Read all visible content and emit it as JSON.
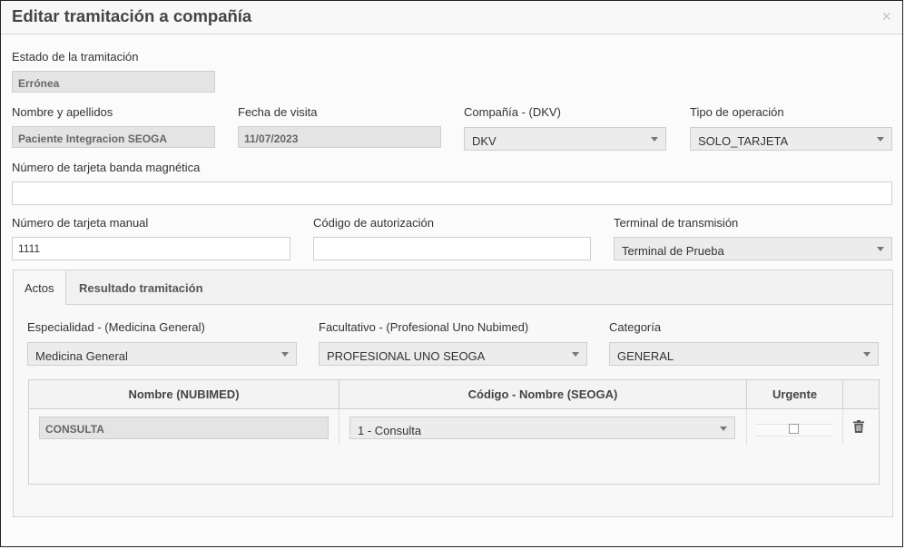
{
  "modal": {
    "title": "Editar tramitación a compañía",
    "close_glyph": "×"
  },
  "estado": {
    "label": "Estado de la tramitación",
    "value": "Errónea"
  },
  "nombre": {
    "label": "Nombre y apellidos",
    "value": "Paciente Integracion SEOGA"
  },
  "fecha": {
    "label": "Fecha de visita",
    "value": "11/07/2023"
  },
  "compania": {
    "label": "Compañía - (DKV)",
    "value": "DKV"
  },
  "tipo_operacion": {
    "label": "Tipo de operación",
    "value": "SOLO_TARJETA"
  },
  "tarjeta_banda": {
    "label": "Número de tarjeta banda magnética",
    "value": ""
  },
  "tarjeta_manual": {
    "label": "Número de tarjeta manual",
    "value": "1111"
  },
  "codigo_autorizacion": {
    "label": "Código de autorización",
    "value": ""
  },
  "terminal": {
    "label": "Terminal de transmisión",
    "value": "Terminal de Prueba"
  },
  "tabs": [
    {
      "label": "Actos",
      "active": true
    },
    {
      "label": "Resultado tramitación",
      "active": false
    }
  ],
  "actos": {
    "especialidad": {
      "label": "Especialidad - (Medicina General)",
      "value": "Medicina General"
    },
    "facultativo": {
      "label": "Facultativo - (Profesional Uno Nubimed)",
      "value": "PROFESIONAL UNO SEOGA"
    },
    "categoria": {
      "label": "Categoría",
      "value": "GENERAL"
    },
    "table": {
      "headers": [
        "Nombre (NUBIMED)",
        "Código - Nombre (SEOGA)",
        "Urgente",
        ""
      ],
      "rows": [
        {
          "nombre": "CONSULTA",
          "codigo": "1 - Consulta",
          "urgente": false
        }
      ]
    }
  },
  "icons": {
    "close": "close-icon",
    "dropdown": "chevron-down-icon",
    "delete": "trash-icon",
    "checkbox": "checkbox-icon"
  }
}
